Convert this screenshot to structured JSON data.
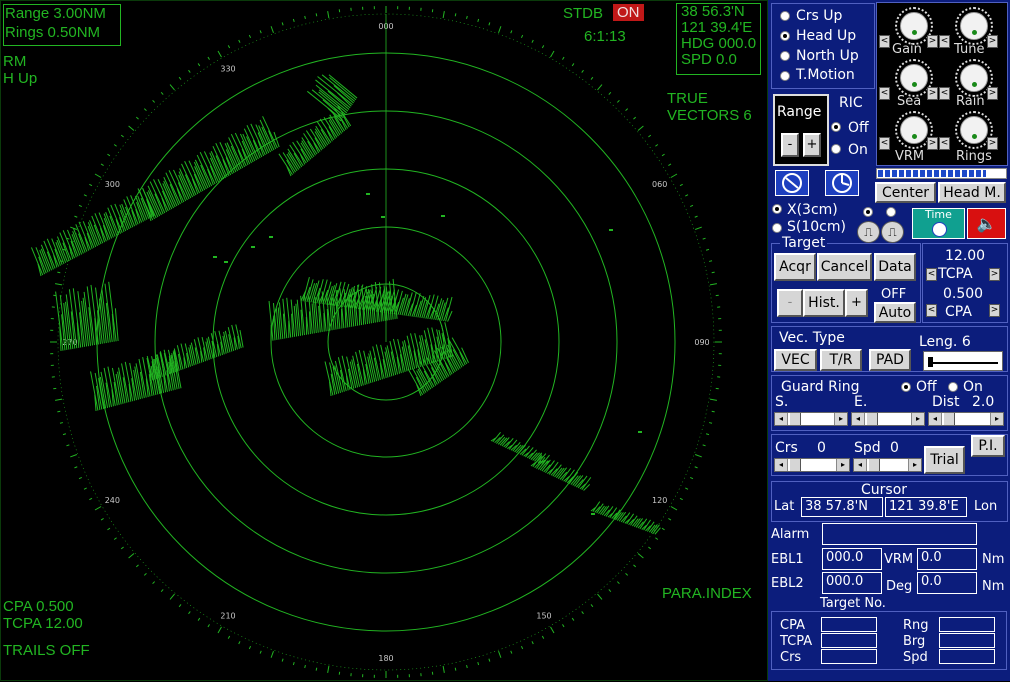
{
  "radar": {
    "range": "Range 3.00NM",
    "rings": "Rings 0.50NM",
    "mode1": "RM",
    "mode2": "H Up",
    "stdb": "STDB",
    "stdb_state": "ON",
    "time": "6:1:13",
    "lat": "38 56.3'N",
    "lon": "121 39.4'E",
    "hdg": "HDG 000.0",
    "spd": "SPD   0.0",
    "true_label": "TRUE",
    "vectors": "VECTORS 6",
    "cpa": "CPA 0.500",
    "tcpa": "TCPA 12.00",
    "trails": "TRAILS OFF",
    "para_index": "PARA.INDEX",
    "bearings": [
      "000",
      "330",
      "300",
      "270",
      "240",
      "210",
      "180",
      "150",
      "120",
      "090",
      "060"
    ],
    "colors": {
      "phosphor": "#22b522",
      "on_badge": "#c01818"
    }
  },
  "panel": {
    "orient": {
      "crs_up": "Crs Up",
      "head_up": "Head  Up",
      "north_up": "North Up",
      "t_motion": "T.Motion",
      "selected": "head_up"
    },
    "knobs": {
      "gain": "Gain",
      "tune": "Tune",
      "sea": "Sea",
      "rain": "Rain",
      "vrm": "VRM",
      "rings": "Rings"
    },
    "range_label": "Range",
    "range_minus": "-",
    "range_plus": "+",
    "ric": "RIC",
    "ric_off": "Off",
    "ric_on": "On",
    "center": "Center",
    "head_m": "Head M.",
    "band_x": "X(3cm)",
    "band_s": "S(10cm)",
    "time_label": "Time",
    "target_title": "Target",
    "acqr": "Acqr",
    "cancel": "Cancel",
    "data": "Data",
    "tcpa_val": "12.00",
    "tcpa_label": "TCPA",
    "cpa_val": "0.500",
    "cpa_label": "CPA",
    "hist_minus": "-",
    "hist": "Hist.",
    "hist_plus": "+",
    "off": "OFF",
    "auto": "Auto",
    "vec_type": "Vec. Type",
    "leng": "Leng. 6",
    "vec": "VEC",
    "tr": "T/R",
    "pad": "PAD",
    "guard_ring": "Guard Ring",
    "gr_off": "Off",
    "gr_on": "On",
    "gr_s": "S.",
    "gr_e": "E.",
    "gr_dist": "Dist",
    "gr_dist_val": "2.0",
    "crs": "Crs",
    "crs_val": "0",
    "spd": "Spd",
    "spd_val": "0",
    "trial": "Trial",
    "pi": "P.I.",
    "cursor_title": "Cursor",
    "lat_label": "Lat",
    "lat_val": "38 57.8'N",
    "lon_val": "121 39.8'E",
    "lon_label": "Lon",
    "alarm": "Alarm",
    "ebl1": "EBL1",
    "ebl1_val": "000.0",
    "vrm": "VRM",
    "vrm_val": "0.0",
    "nm1": "Nm",
    "ebl2": "EBL2",
    "ebl2_val": "000.0",
    "deg": "Deg",
    "deg_val": "0.0",
    "nm2": "Nm",
    "target_no": "Target No.",
    "t_cpa": "CPA",
    "t_tcpa": "TCPA",
    "t_crs": "Crs",
    "t_rng": "Rng",
    "t_brg": "Brg",
    "t_spd": "Spd"
  }
}
